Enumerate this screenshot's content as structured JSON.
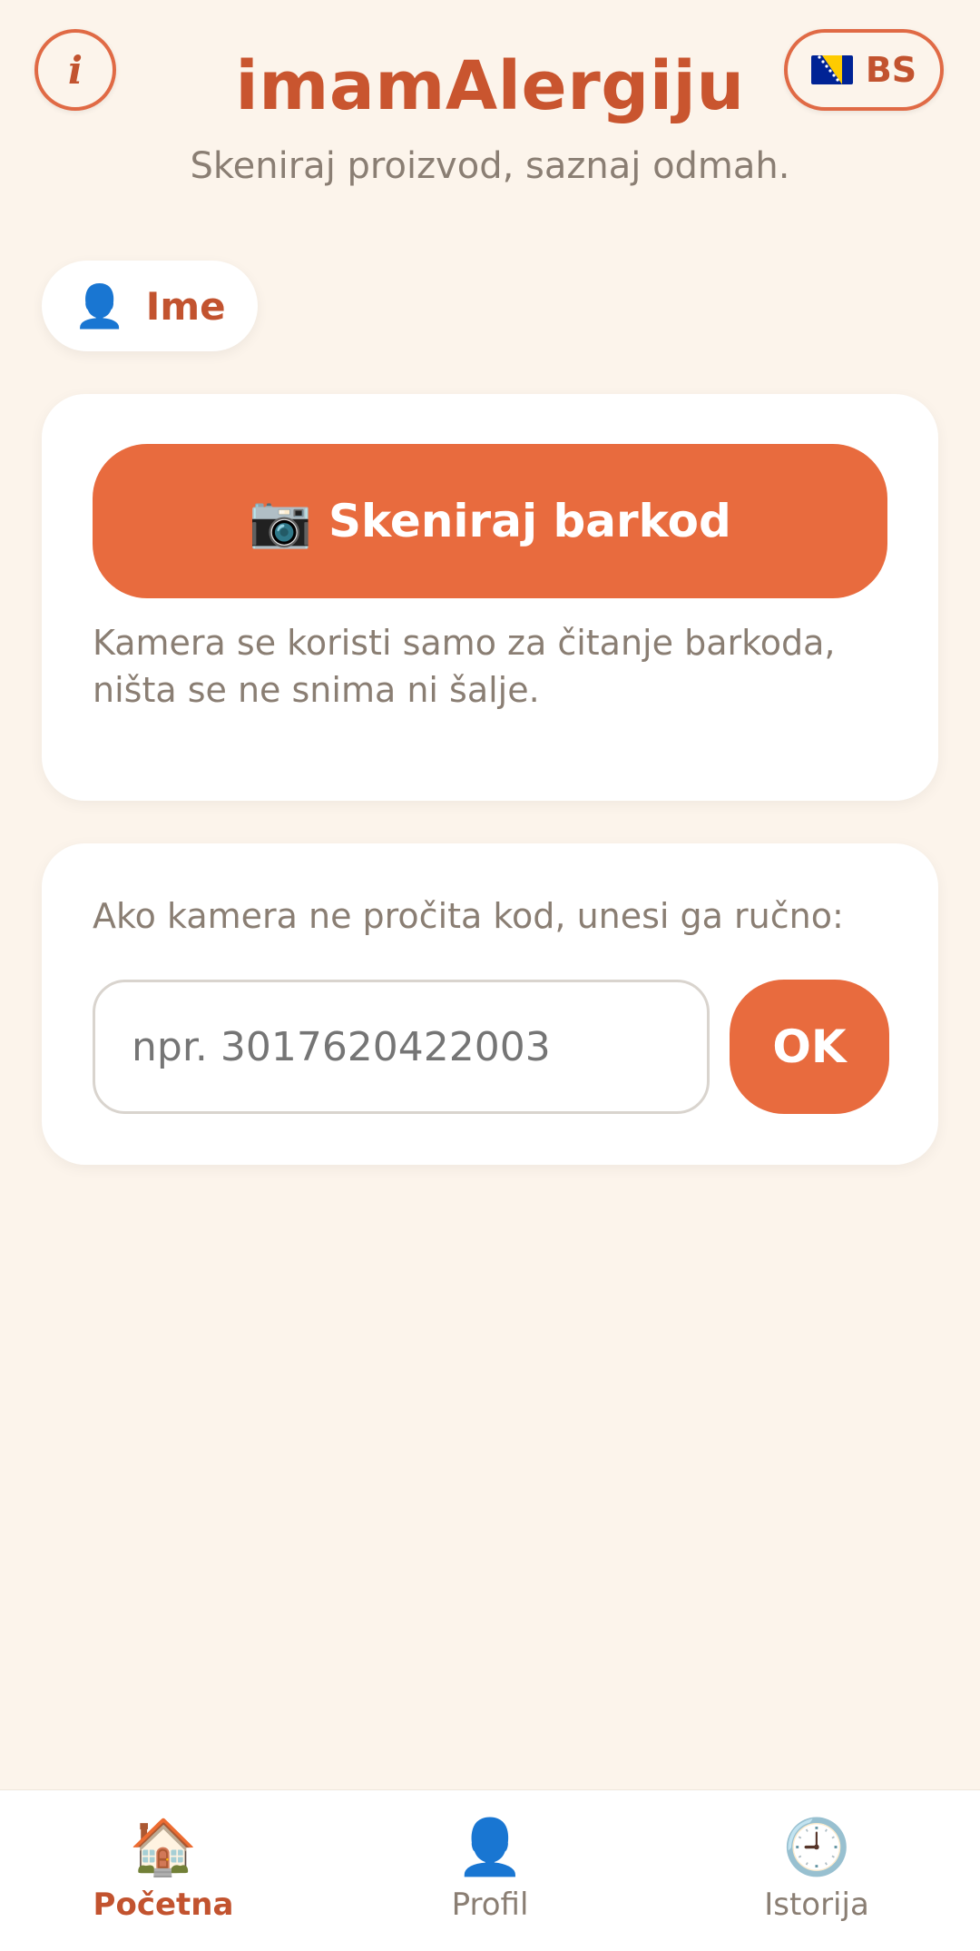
{
  "header": {
    "info_label": "i",
    "title": "imamAlergiju",
    "subtitle": "Skeniraj proizvod, saznaj odmah.",
    "language": "BS"
  },
  "profile_chip": {
    "icon": "person-icon",
    "label": "Ime"
  },
  "scan_card": {
    "button_icon": "camera-icon",
    "button_label": "Skeniraj barkod",
    "note": "Kamera se koristi samo za čitanje barkoda, ništa se ne snima ni šalje."
  },
  "manual_card": {
    "label": "Ako kamera ne pročita kod, unesi ga ručno:",
    "input_placeholder": "npr. 3017620422003",
    "input_value": "",
    "ok_label": "OK"
  },
  "bottom_nav": {
    "items": [
      {
        "icon": "home-icon",
        "label": "Početna",
        "active": true
      },
      {
        "icon": "profile-icon",
        "label": "Profil",
        "active": false
      },
      {
        "icon": "history-icon",
        "label": "Istorija",
        "active": false
      }
    ]
  },
  "colors": {
    "background": "#fcf4eb",
    "accent": "#e86b3e",
    "accent_text": "#c9552f",
    "muted_text": "#8a7e73",
    "card": "#ffffff"
  }
}
